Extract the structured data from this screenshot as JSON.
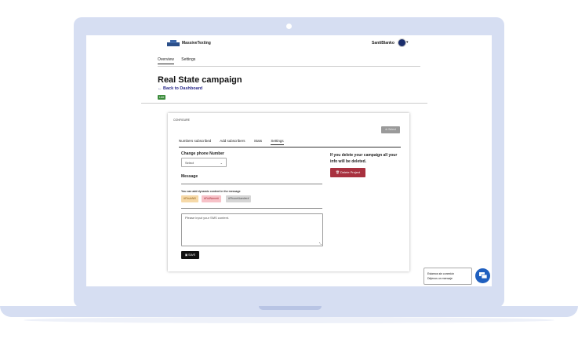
{
  "nav": {
    "brand": "MassiveTexting",
    "user": "SantiBlanko",
    "tabs": [
      "Overview",
      "Settings"
    ]
  },
  "page": {
    "title": "Real State campaign",
    "back_link": "← Back to Dashboard",
    "status_badge": "Live"
  },
  "card": {
    "title": "CONFIGURE",
    "top_button": "⊘ Select",
    "tabs": [
      "Numbers subscribed",
      "Add subscribers",
      "Stats",
      "Settings"
    ],
    "phone_label": "Change phone Number",
    "select_value": "Select",
    "message_label": "Message",
    "dynamic_note": "You can add dynamic content in the message",
    "chips": [
      "#FirstnNN",
      "#FullName#",
      "#PhoneNumber#"
    ],
    "textarea_placeholder": "Please input your SMS content.",
    "save_label": "SAVE",
    "delete_note": "If you delete your campaign all your info will be deleted.",
    "delete_label": "Delete Project"
  },
  "chat": {
    "line1": "Estamos sin conexión",
    "line2": "Déjenos un mensaje"
  },
  "colors": {
    "accent": "#1f5fbf",
    "danger": "#a8313f",
    "success": "#3c8c3c",
    "laptop": "#d6def2"
  }
}
